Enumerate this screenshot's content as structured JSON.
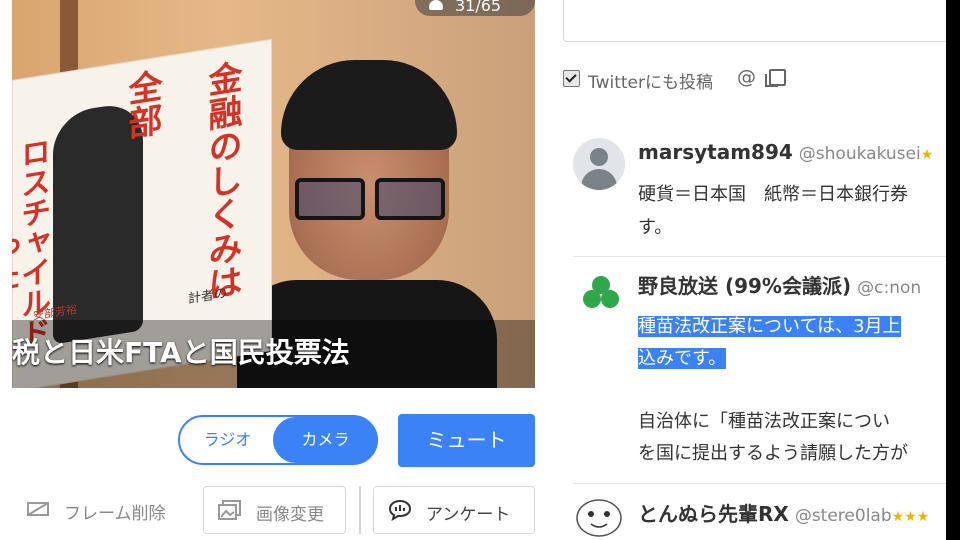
{
  "video": {
    "viewer_count": "31/65",
    "ticker_text": "税と日米FTAと国民投票法",
    "book_title_line1": "金融のしくみは",
    "book_title_line2": "全部",
    "book_title_line3": "ロスチャイルド",
    "book_title_line4": "った",
    "book_author_fragment": "安部芳裕",
    "book_subtitle_fragment": "計者の"
  },
  "controls": {
    "toggle_radio": "ラジオ",
    "toggle_camera": "カメラ",
    "toggle_selected": "カメラ",
    "mute_label": "ミュート",
    "frame_delete": "フレーム削除",
    "image_change": "画像変更",
    "survey": "アンケート"
  },
  "compose": {
    "twitter_checkbox_label": "Twitterにも投稿",
    "twitter_checked": true
  },
  "comments": [
    {
      "username": "marsytam894",
      "handle": "@shoukakusei",
      "lines": [
        "硬貨＝日本国　紙幣＝日本銀行券",
        "す。"
      ]
    },
    {
      "username": "野良放送 (99%会議派)",
      "handle": "@c:non",
      "highlighted_lines": [
        "種苗法改正案については、3月上",
        "込みです。"
      ],
      "lines": [
        "自治体に「種苗法改正案につい",
        "を国に提出するよう請願した方が"
      ]
    },
    {
      "username": "とんぬら先輩RX",
      "handle": "@stere0lab"
    }
  ],
  "colors": {
    "accent": "#3b82f6",
    "book_title_red": "#d33226",
    "clover_green": "#2ea84a"
  }
}
